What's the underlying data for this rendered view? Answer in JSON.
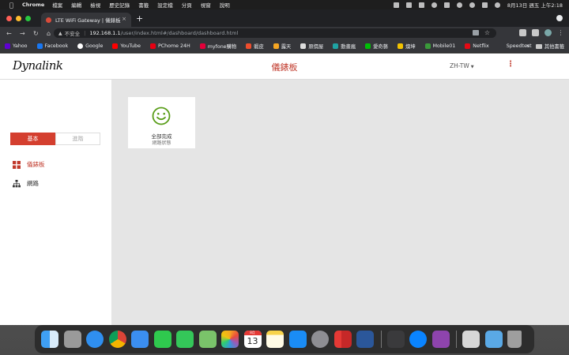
{
  "menubar": {
    "app": "Chrome",
    "items": [
      "檔案",
      "編輯",
      "檢視",
      "歷史記錄",
      "書籤",
      "設定檔",
      "分頁",
      "視窗",
      "說明"
    ],
    "clock": "8月13日 週五 上午2:18"
  },
  "tab": {
    "title": "LTE WiFi Gateway | 儀錶板",
    "close": "×"
  },
  "newtab": "+",
  "address": {
    "security_label": "不安全",
    "host": "192.168.1.1",
    "path": "/user/index.html#/dashboard/dashboard.html"
  },
  "bookmarks": [
    {
      "label": "Yahoo",
      "color": "#6001d2"
    },
    {
      "label": "Facebook",
      "color": "#1877f2"
    },
    {
      "label": "Google",
      "color": "#ffffff"
    },
    {
      "label": "YouTube",
      "color": "#ff0000"
    },
    {
      "label": "PChome 24H",
      "color": "#e60012"
    },
    {
      "label": "myfone購物",
      "color": "#e4003a"
    },
    {
      "label": "蝦皮",
      "color": "#ee4d2d"
    },
    {
      "label": "露天",
      "color": "#f5a623"
    },
    {
      "label": "原價屋",
      "color": "#dddddd"
    },
    {
      "label": "動畫瘋",
      "color": "#1fa3a3"
    },
    {
      "label": "愛奇藝",
      "color": "#00be06"
    },
    {
      "label": "燦坤",
      "color": "#f3c300"
    },
    {
      "label": "Mobile01",
      "color": "#3a9a3a"
    },
    {
      "label": "Netflix",
      "color": "#e50914"
    },
    {
      "label": "Speedtest",
      "color": "#35363a"
    }
  ],
  "bookmarks_more": "»",
  "bookmarks_other": "其他書籤",
  "app": {
    "logo": "Dynalink",
    "title": "儀錶板",
    "language": "ZH-TW"
  },
  "sidebar": {
    "mode_basic": "基本",
    "mode_advanced": "進階",
    "items": [
      {
        "label": "儀錶板"
      },
      {
        "label": "網路"
      }
    ]
  },
  "status_card": {
    "status": "全部完成",
    "label": "網路狀態",
    "color": "#5a9e1a"
  },
  "colors": {
    "accent": "#c0392b",
    "button_active": "#d43f2f"
  },
  "dock": {
    "calendar_month": "8月",
    "calendar_day": "13",
    "apps": [
      "finder",
      "launchpad",
      "safari",
      "chrome",
      "mail",
      "facetime",
      "messages",
      "maps",
      "photos",
      "calendar",
      "notes",
      "app-store",
      "system-preferences",
      "parallels",
      "word",
      "calculator",
      "wifi-utility",
      "podcasts",
      "preview",
      "folder",
      "trash"
    ]
  }
}
